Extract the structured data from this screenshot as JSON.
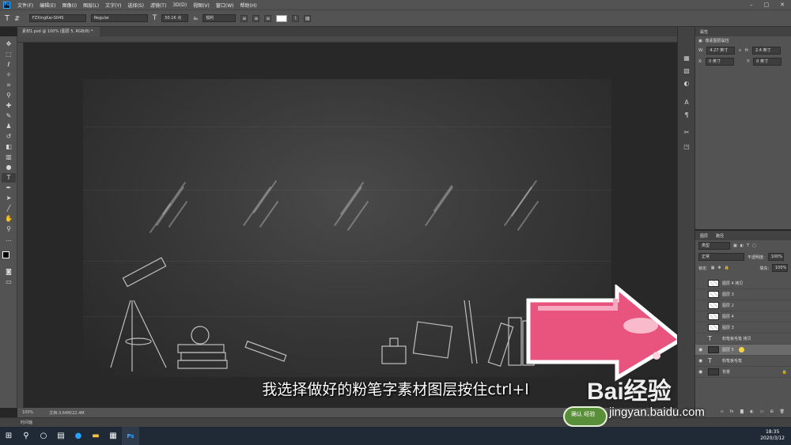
{
  "menu": [
    "文件(F)",
    "编辑(E)",
    "图像(I)",
    "图层(L)",
    "文字(Y)",
    "选择(S)",
    "滤镜(T)",
    "3D(D)",
    "视图(V)",
    "窗口(W)",
    "帮助(H)"
  ],
  "options": {
    "font_family": "FZXingKai-S04S",
    "font_style": "Regular",
    "font_size": "50.16 点",
    "antialias": "锐利",
    "text_color": "#ffffff"
  },
  "document": {
    "tab_title": "素材1.psd @ 100% (图层 5, RGB/8) *",
    "zoom": "100%",
    "doc_size": "文档:3.64M/22.4M"
  },
  "properties": {
    "tab": "属性",
    "section": "像素图层属性",
    "w": "4.27 英寸",
    "h": "2.4 英寸",
    "x": "0 英寸",
    "y": "0 英寸"
  },
  "layers_panel": {
    "tabs": [
      "图层",
      "路径"
    ],
    "filter": "类型",
    "blend_mode": "正常",
    "opacity_label": "不透明度:",
    "opacity": "100%",
    "lock_label": "锁定:",
    "fill_label": "填充:",
    "fill": "100%",
    "layers": [
      {
        "name": "图层 4 拷贝",
        "kind": "pixel"
      },
      {
        "name": "图层 3",
        "kind": "pixel"
      },
      {
        "name": "图层 2",
        "kind": "pixel"
      },
      {
        "name": "图层 4",
        "kind": "pixel"
      },
      {
        "name": "图层 3",
        "kind": "pixel"
      },
      {
        "name": "粉笔板毛笔 拷贝",
        "kind": "text"
      },
      {
        "name": "图层 5",
        "kind": "dark",
        "selected": true
      },
      {
        "name": "粉笔板毛笔",
        "kind": "text"
      },
      {
        "name": "背景",
        "kind": "dark"
      }
    ]
  },
  "timeline_label": "时间轴",
  "subtitle": "我选择做好的粉笔字素材图层按住ctrl+l",
  "watermark": {
    "brand": "Bai经验",
    "url": "jingyan.baidu.com",
    "badge": "确认 \n 经验"
  },
  "taskbar": {
    "time": "18:35",
    "date": "2020/3/12"
  },
  "colors": {
    "accent": "#e8547e",
    "badge": "#5a8f3a"
  }
}
